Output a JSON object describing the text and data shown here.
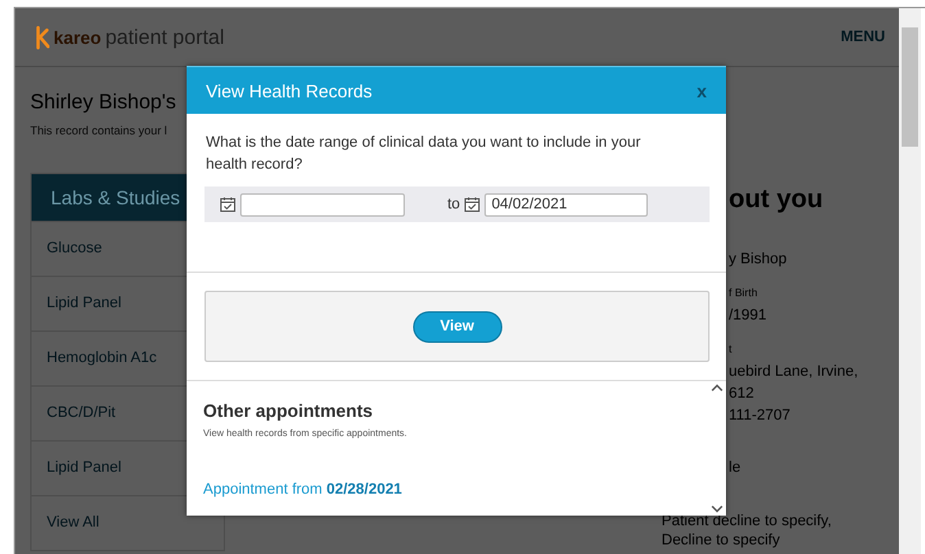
{
  "header": {
    "brand": "kareo",
    "product": "patient portal",
    "menu": "MENU"
  },
  "record": {
    "title": "Shirley Bishop's",
    "subtitle": "This record contains your l"
  },
  "labs": {
    "heading": "Labs & Studies",
    "items": [
      "Glucose",
      "Lipid Panel",
      "Hemoglobin A1c",
      "CBC/D/Pit",
      "Lipid Panel",
      "View All"
    ]
  },
  "about": {
    "heading": "out you",
    "sections": [
      {
        "lines": [
          "y Bishop"
        ]
      },
      {
        "label": "f Birth",
        "lines": [
          "/1991"
        ]
      },
      {
        "label": "t",
        "lines": [
          "uebird Lane, Irvine,",
          "612",
          "111-2707"
        ]
      },
      {
        "lines": [
          "le"
        ]
      },
      {
        "lines": [
          "Patient decline to specify,",
          "Decline to specify"
        ]
      }
    ]
  },
  "modal": {
    "title": "View Health Records",
    "close": "x",
    "question": "What is the date range of clinical data you want to include in your health record?",
    "to_label": "to",
    "date_to": {
      "value": "04/02/2021"
    },
    "view_button": "View",
    "other": {
      "heading": "Other appointments",
      "description": "View health records from specific appointments.",
      "link": "Appointment from **02/28/2021**"
    }
  }
}
